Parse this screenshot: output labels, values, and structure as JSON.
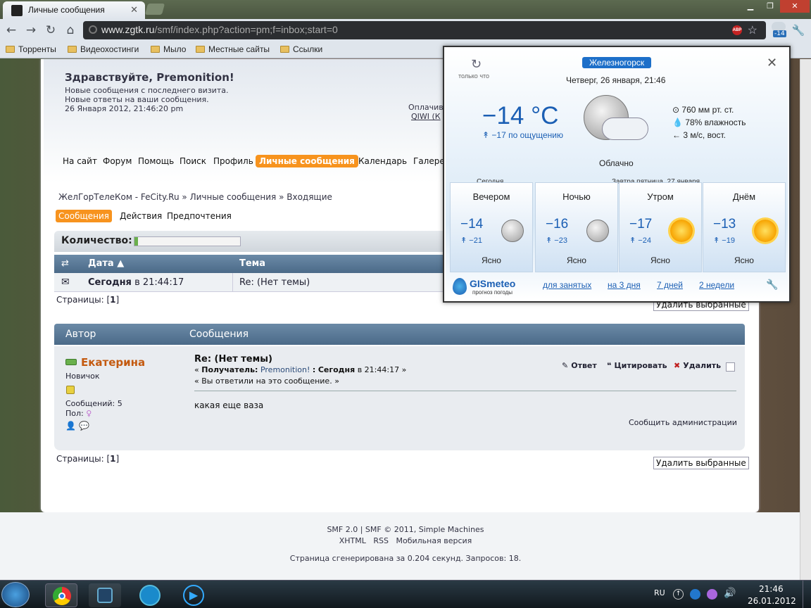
{
  "browser": {
    "tab_title": "Личные сообщения",
    "tab_close": "✕",
    "url_host": "www.zgtk.ru",
    "url_path": "/smf/index.php?action=pm;f=inbox;start=0",
    "abp_label": "ABP",
    "ext_badge": "-14",
    "bookmarks": [
      "Торренты",
      "Видеохостинги",
      "Мыло",
      "Местные сайты",
      "Ссылки"
    ]
  },
  "forum": {
    "greeting": "Здравствуйте, Premonition!",
    "lines": [
      "Новые сообщения с последнего визита.",
      "Новые ответы на ваши сообщения.",
      "26 Января 2012, 21:46:20 pm"
    ],
    "pay_label": "Оплачив",
    "pay_link": "QIWI (К",
    "menu": [
      "На сайт",
      "Форум",
      "Помощь",
      "Поиск",
      "Профиль",
      "Личные сообщения",
      "Календарь",
      "Галерея"
    ],
    "menu_active": "Личные сообщения",
    "breadcrumb": [
      "ЖелГорТелеКом - FeCity.Ru",
      "Личные сообщения",
      "Входящие"
    ],
    "breadcrumb_sep": "»",
    "subtabs": [
      "Сообщения",
      "Действия",
      "Предпочтения"
    ],
    "quantity_label": "Количество:",
    "table_headers": {
      "date": "Дата",
      "subject": "Тема"
    },
    "row": {
      "date_bold": "Сегодня",
      "date_rest": "в 21:44:17",
      "subject": "Re: (Нет темы)"
    },
    "pages_label": "Страницы:",
    "pages_value": "1",
    "delete_button": "Удалить выбранные",
    "list_headers": {
      "author": "Автор",
      "messages": "Сообщения"
    },
    "post": {
      "author": "Екатерина",
      "rank": "Новичок",
      "posts_label": "Сообщений: 5",
      "gender_label": "Пол:",
      "subject": "Re: (Нет темы)",
      "meta_prefix": "« ",
      "meta_to_label": "Получатель:",
      "meta_to": "Premonition!",
      "meta_date_sep": ":",
      "meta_date_bold": "Сегодня",
      "meta_date_rest": "в 21:44:17 »",
      "replied": "« Вы ответили на это сообщение. »",
      "body": "какая еще ваза",
      "report": "Сообщить администрации",
      "actions": [
        "Ответ",
        "Цитировать",
        "Удалить"
      ]
    },
    "footer": {
      "line1": "SMF 2.0 | SMF © 2011, Simple Machines",
      "links": [
        "XHTML",
        "RSS",
        "Мобильная версия"
      ],
      "line3": "Страница сгенерирована за 0.204 секунд. Запросов: 18."
    }
  },
  "weather": {
    "refresh_label": "только что",
    "city": "Железногорск",
    "datetime": "Четверг, 26 января, 21:46",
    "temp": "−14 °C",
    "feels": "−17 по ощущению",
    "pressure": "760 мм рт. ст.",
    "humidity": "78% влажность",
    "wind": "← 3 м/с, вост.",
    "condition": "Облачно",
    "today_label": "Сегодня",
    "tomorrow_label": "Завтра пятница, 27 января",
    "periods": [
      {
        "name": "Вечером",
        "temp": "−14",
        "feels": "−21",
        "cond": "Ясно",
        "icon": "moon"
      },
      {
        "name": "Ночью",
        "temp": "−16",
        "feels": "−23",
        "cond": "Ясно",
        "icon": "moon"
      },
      {
        "name": "Утром",
        "temp": "−17",
        "feels": "−24",
        "cond": "Ясно",
        "icon": "sun"
      },
      {
        "name": "Днём",
        "temp": "−13",
        "feels": "−19",
        "cond": "Ясно",
        "icon": "sun"
      }
    ],
    "brand": "GISmeteo",
    "brand_sub": "прогноз погоды",
    "links": [
      "для занятых",
      "на 3 дня",
      "7 дней",
      "2 недели"
    ]
  },
  "taskbar": {
    "lang": "RU",
    "time": "21:46",
    "date": "26.01.2012"
  }
}
